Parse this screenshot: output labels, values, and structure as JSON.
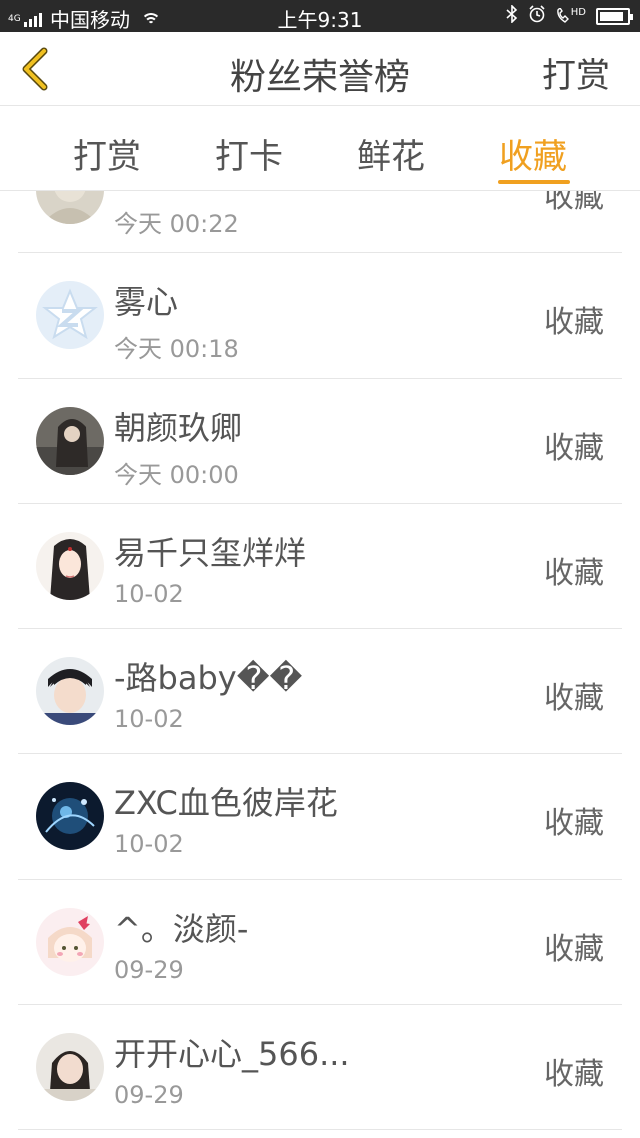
{
  "status_bar": {
    "network": "4G",
    "carrier": "中国移动",
    "time": "上午9:31",
    "right_icons": [
      "bluetooth-icon",
      "alarm-icon",
      "hd-call-icon",
      "battery-icon"
    ],
    "hd_label": "HD",
    "battery_level": 0.9
  },
  "header": {
    "title": "粉丝荣誉榜",
    "right_action": "打赏",
    "back_icon": "chevron-left-icon",
    "accent_color": "#f0a020"
  },
  "tabs": [
    {
      "label": "打赏",
      "active": false
    },
    {
      "label": "打卡",
      "active": false
    },
    {
      "label": "鲜花",
      "active": false
    },
    {
      "label": "收藏",
      "active": true
    }
  ],
  "list": [
    {
      "name": "",
      "time": "今天 00:22",
      "action": "收藏",
      "avatar": "avatar-user-0"
    },
    {
      "name": "雾心",
      "time": "今天 00:18",
      "action": "收藏",
      "avatar": "avatar-default-qq"
    },
    {
      "name": "朝颜玖卿",
      "time": "今天 00:00",
      "action": "收藏",
      "avatar": "avatar-user-2"
    },
    {
      "name": "易千只玺烊烊",
      "time": "10-02",
      "action": "收藏",
      "avatar": "avatar-user-3"
    },
    {
      "name": "-路baby��",
      "time": "10-02",
      "action": "收藏",
      "avatar": "avatar-user-4"
    },
    {
      "name": "ZXC血色彼岸花",
      "time": "10-02",
      "action": "收藏",
      "avatar": "avatar-user-5"
    },
    {
      "name": "^。淡颜-",
      "time": "09-29",
      "action": "收藏",
      "avatar": "avatar-user-6"
    },
    {
      "name": "开开心心_566...",
      "time": "09-29",
      "action": "收藏",
      "avatar": "avatar-user-7"
    }
  ]
}
